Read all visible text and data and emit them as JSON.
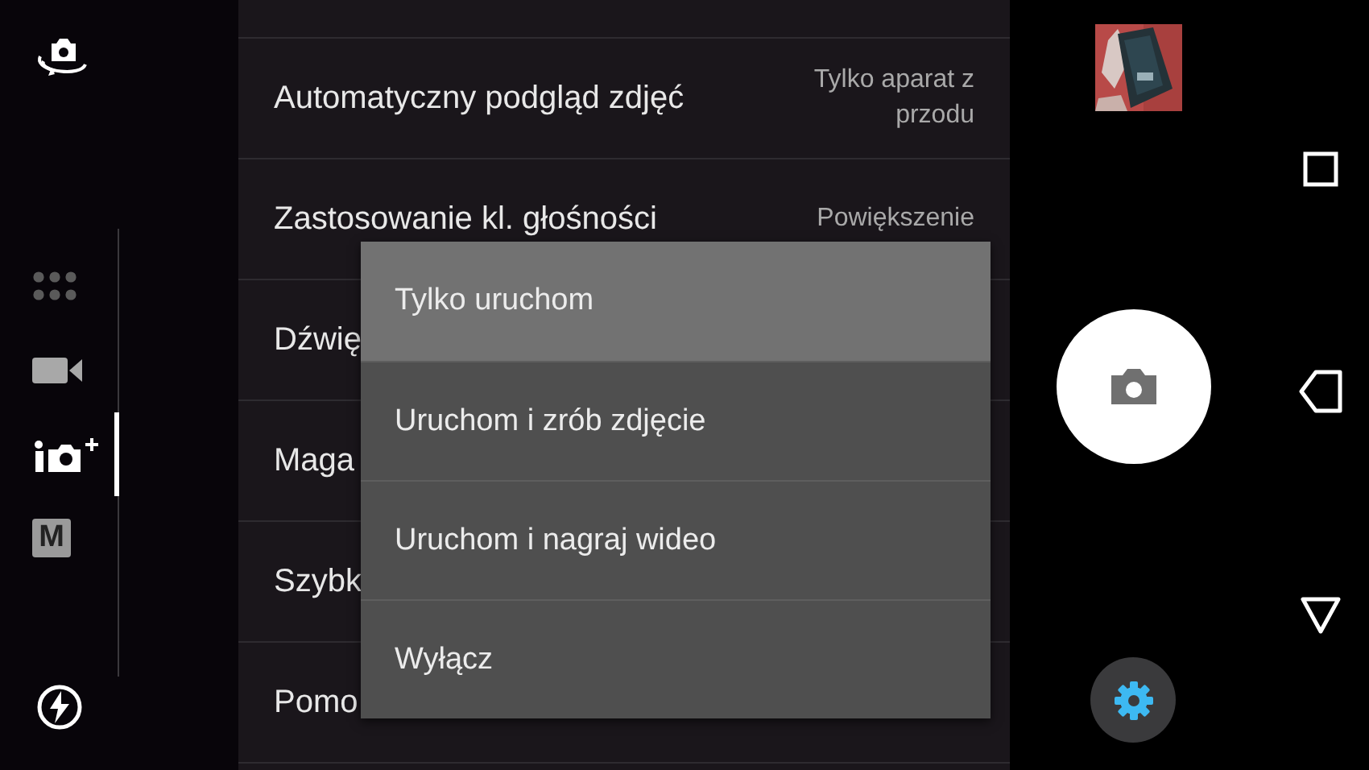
{
  "rail": {
    "modes": [
      {
        "kind": "grid",
        "selected": false
      },
      {
        "kind": "video",
        "selected": false
      },
      {
        "kind": "superior-auto",
        "selected": true
      },
      {
        "kind": "manual",
        "label": "M",
        "selected": false
      }
    ]
  },
  "settings": [
    {
      "label": "Automatyczny podgląd zdjęć",
      "value": "Tylko aparat z przodu"
    },
    {
      "label": "Zastosowanie kl. głośności",
      "value": "Powiększenie"
    },
    {
      "label": "Dźwię"
    },
    {
      "label": "Maga"
    },
    {
      "label": "Szybk"
    },
    {
      "label": "Pomo"
    }
  ],
  "menu": {
    "options": [
      {
        "label": "Tylko uruchom",
        "selected": true
      },
      {
        "label": "Uruchom i zrób zdjęcie",
        "selected": false
      },
      {
        "label": "Uruchom i nagraj wideo",
        "selected": false
      },
      {
        "label": "Wyłącz",
        "selected": false
      }
    ]
  }
}
